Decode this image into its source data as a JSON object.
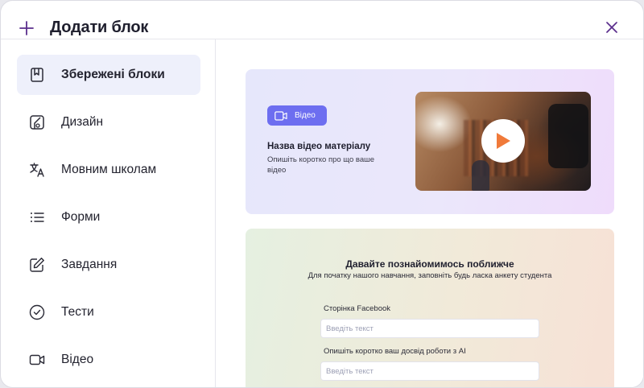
{
  "header": {
    "title": "Додати блок"
  },
  "sidebar": {
    "items": [
      {
        "label": "Збережені блоки",
        "icon": "bookmark-icon",
        "active": true
      },
      {
        "label": "Дизайн",
        "icon": "design-icon"
      },
      {
        "label": "Мовним школам",
        "icon": "translate-icon"
      },
      {
        "label": "Форми",
        "icon": "list-icon"
      },
      {
        "label": "Завдання",
        "icon": "edit-icon"
      },
      {
        "label": "Тести",
        "icon": "check-circle-icon"
      },
      {
        "label": "Відео",
        "icon": "video-icon"
      }
    ]
  },
  "video_card": {
    "badge": "Відео",
    "title": "Назва відео матеріалу",
    "description": "Опишіть коротко про що ваше відео"
  },
  "form_card": {
    "title": "Давайте познайомимось поближче",
    "subtitle": "Для початку нашого навчання, заповніть будь ласка анкету студента",
    "fields": [
      {
        "label": "Сторінка Facebook",
        "placeholder": "Введіть текст"
      },
      {
        "label": "Опишіть коротко ваш досвід роботи з AI",
        "placeholder": "Введіть текст"
      }
    ]
  },
  "colors": {
    "accent": "#5a2d8c",
    "badge": "#6d6ef0",
    "play": "#f07a3a",
    "active_bg": "#eef0fb"
  }
}
